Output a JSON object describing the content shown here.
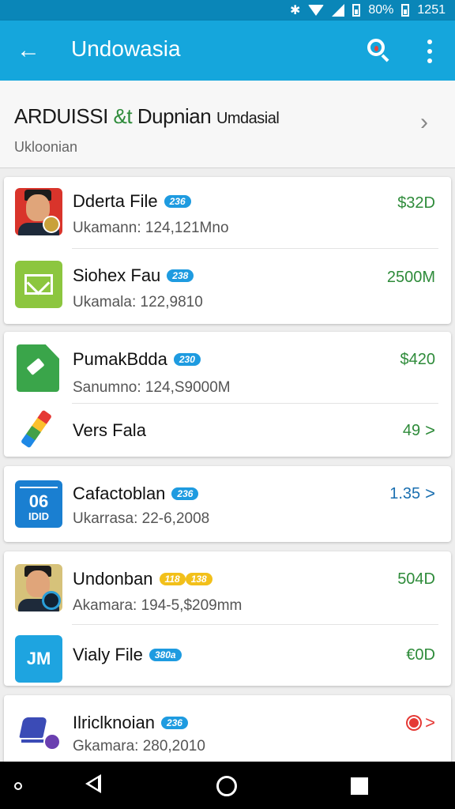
{
  "status_bar": {
    "battery": "80%",
    "time": "1251"
  },
  "app_bar": {
    "title": "Undowasia"
  },
  "header": {
    "title_part1": "ARDUISSI",
    "title_accent": "&t",
    "title_part2": "Dupnian",
    "title_part3": "Umdasial",
    "subtitle": "Ukloonian"
  },
  "items": [
    {
      "title": "Dderta File",
      "badge": "236",
      "sub": "Ukamann: 124,121Mno",
      "value": "$32D"
    },
    {
      "title": "Siohex Fau",
      "badge": "238",
      "sub": "Ukamala: 122,9810",
      "value": "2500M"
    },
    {
      "title": "PumakBdda",
      "badge": "230",
      "sub": "Sanumno: 124,S9000M",
      "value": "$420"
    },
    {
      "title": "Vers Fala",
      "value": "49",
      "chevron": ">"
    },
    {
      "title": "Cafactoblan",
      "badge": "236",
      "sub": "Ukarrasa: 22-6,2008",
      "value": "1.35",
      "chevron": ">",
      "icon_day": "06",
      "icon_label": "IDID"
    },
    {
      "title": "Undonban",
      "badges": [
        "118",
        "138"
      ],
      "sub": "Akamara: 194-5,$209mm",
      "value": "504D"
    },
    {
      "title": "Vialy File",
      "badge": "380a",
      "value": "€0D",
      "icon_text": "JM"
    },
    {
      "title": "Ilriclknoian",
      "badge": "236",
      "sub": "Gkamara: 280,2010",
      "chevron": ">"
    }
  ],
  "colors": {
    "app_bar": "#15a6dc",
    "value_green": "#2e8b3a",
    "badge_blue": "#1e9be0",
    "badge_yellow": "#f2c01a"
  }
}
